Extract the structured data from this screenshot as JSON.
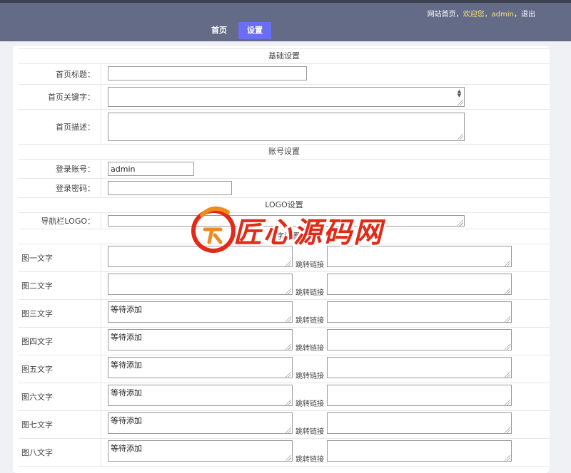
{
  "header": {
    "toplinks": {
      "site_home": "网站首页",
      "sep1": "，",
      "welcome": "欢迎您，admin",
      "sep2": "，",
      "logout": "退出"
    },
    "nav": {
      "home": "首页",
      "settings": "设置"
    }
  },
  "form": {
    "basic": {
      "title": "基础设置",
      "home_title_label": "首页标题：",
      "home_title_value": "",
      "keywords_label": "首页关键字：",
      "keywords_value": "",
      "desc_label": "首页描述：",
      "desc_value": ""
    },
    "account": {
      "title": "账号设置",
      "login_label": "登录账号：",
      "login_value": "admin",
      "password_label": "登录密码：",
      "password_value": ""
    },
    "logo": {
      "title": "LOGO设置",
      "nav_logo_label": "导航栏LOGO：",
      "nav_logo_value": ""
    },
    "images": {
      "title": "文字设置",
      "jump_label": "跳转链接",
      "rows": [
        {
          "label": "图一文字",
          "text": "",
          "link": ""
        },
        {
          "label": "图二文字",
          "text": "",
          "link": ""
        },
        {
          "label": "图三文字",
          "text": "等待添加",
          "link": ""
        },
        {
          "label": "图四文字",
          "text": "等待添加",
          "link": ""
        },
        {
          "label": "图五文字",
          "text": "等待添加",
          "link": ""
        },
        {
          "label": "图六文字",
          "text": "等待添加",
          "link": ""
        },
        {
          "label": "图七文字",
          "text": "等待添加",
          "link": ""
        },
        {
          "label": "图八文字",
          "text": "等待添加",
          "link": ""
        }
      ]
    }
  },
  "watermark": {
    "text": "匠心源码网"
  },
  "colors": {
    "header_bg": "#646b87",
    "nav_active": "#6a6ef0",
    "welcome": "#f5e27a",
    "watermark": "#e12b18"
  }
}
